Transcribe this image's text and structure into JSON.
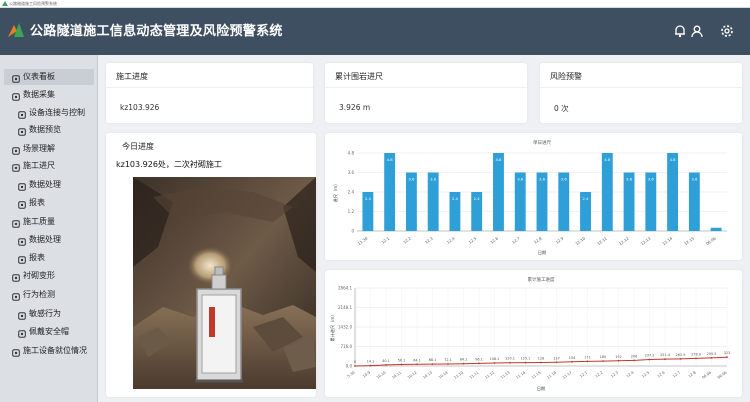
{
  "window": {
    "title": "公路隧道施工风险预警系统"
  },
  "header": {
    "title": "公路隧道施工信息动态管理及风险预警系统",
    "icons": [
      "bell-icon",
      "user-icon",
      "gear-icon"
    ]
  },
  "sidebar": {
    "items": [
      {
        "label": "仪表看板",
        "icon": "dashboard-icon",
        "level": 1,
        "active": true
      },
      {
        "label": "数据采集",
        "icon": "database-icon",
        "level": 1
      },
      {
        "label": "设备连接与控制",
        "icon": "link-icon",
        "level": 2
      },
      {
        "label": "数据预览",
        "icon": "eye-icon",
        "level": 2
      },
      {
        "label": "场景理解",
        "icon": "scene-icon",
        "level": 1
      },
      {
        "label": "施工进尺",
        "icon": "chart-icon",
        "level": 1
      },
      {
        "label": "数据处理",
        "icon": "process-icon",
        "level": 2
      },
      {
        "label": "报表",
        "icon": "report-icon",
        "level": 2
      },
      {
        "label": "施工质量",
        "icon": "quality-icon",
        "level": 1
      },
      {
        "label": "数据处理",
        "icon": "process-icon",
        "level": 2
      },
      {
        "label": "报表",
        "icon": "report-icon",
        "level": 2
      },
      {
        "label": "衬砌变形",
        "icon": "deform-icon",
        "level": 1
      },
      {
        "label": "行为检测",
        "icon": "behavior-icon",
        "level": 1
      },
      {
        "label": "敏感行为",
        "icon": "warning-icon",
        "level": 2
      },
      {
        "label": "佩戴安全帽",
        "icon": "helmet-icon",
        "level": 2
      },
      {
        "label": "施工设备就位情况",
        "icon": "equipment-icon",
        "level": 1
      }
    ]
  },
  "cards": {
    "mileage": {
      "title": "施工进度",
      "value": "kz103.926"
    },
    "footage": {
      "title": "累计围岩进尺",
      "value": "3.926 m"
    },
    "risk": {
      "title": "风险预警",
      "value": "0  次"
    }
  },
  "progress": {
    "title": "今日进度",
    "description": "kz103.926处，二次衬砌施工"
  },
  "colors": {
    "header": "#3f4f62",
    "bar": "#2f9fd8",
    "line": "#c0392b",
    "accent": "#3aa655"
  },
  "chart_data": [
    {
      "type": "bar",
      "title": "单日进尺",
      "xlabel": "日期",
      "ylabel": "进尺（m）",
      "ylim": [
        0,
        4.8
      ],
      "yticks": [
        0,
        1.2,
        2.4,
        3.6,
        4.8
      ],
      "categories": [
        "11.30",
        "12.1",
        "12.2",
        "12.3",
        "12.4",
        "12.5",
        "12.6",
        "12.7",
        "12.8",
        "12.9",
        "12.10",
        "12.11",
        "12.12",
        "12.13",
        "12.14",
        "12.15",
        "06.06"
      ],
      "values": [
        2.4,
        4.8,
        3.6,
        3.6,
        2.4,
        2.4,
        4.8,
        3.6,
        3.6,
        3.6,
        2.4,
        4.8,
        3.6,
        3.6,
        4.8,
        3.6,
        0.2
      ],
      "value_labels": [
        "2.4",
        "4.8",
        "3.6",
        "3.6",
        "2.4",
        "2.4",
        "4.8",
        "3.6",
        "3.6",
        "3.6",
        "2.4",
        "4.8",
        "3.6",
        "3.6",
        "4.8",
        "3.6",
        ""
      ]
    },
    {
      "type": "line",
      "title": "累计施工进度",
      "xlabel": "日期",
      "ylabel": "累计进尺（m）",
      "ylim": [
        0,
        2864.1
      ],
      "yticks": [
        "0.0",
        "716.0",
        "1432.0",
        "2148.1",
        "2864.1"
      ],
      "categories": [
        "5.30",
        "10.9",
        "10.10",
        "10.11",
        "10.12",
        "10.13",
        "10.14",
        "11.10",
        "11.11",
        "11.12",
        "11.13",
        "11.14",
        "11.15",
        "11.16",
        "11.17",
        "12.1",
        "12.2",
        "12.3",
        "12.4",
        "12.5",
        "12.6",
        "12.7",
        "12.8",
        "06.06",
        "06.06"
      ],
      "values": [
        0,
        14.1,
        40.1,
        56.1,
        64.1,
        68.1,
        72.1,
        84.1,
        96.1,
        108.1,
        120.1,
        125.1,
        128.1,
        137,
        154.1,
        171,
        180,
        192,
        206,
        237,
        251,
        262,
        278,
        299,
        323
      ],
      "value_labels": [
        "0",
        "14.1",
        "40.1",
        "56.1",
        "64.1",
        "68.1",
        "72.1",
        "84.1",
        "96.1",
        "108.1",
        "120.1",
        "125.1",
        "128",
        "137",
        "154",
        "171",
        "180",
        "192",
        "206",
        "237.2",
        "251.4",
        "262.9",
        "278.9",
        "299.5",
        "323"
      ]
    }
  ]
}
